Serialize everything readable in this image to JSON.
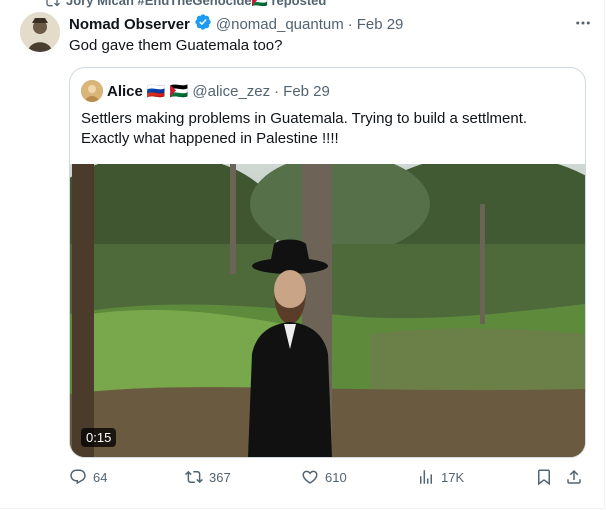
{
  "repost": {
    "label": "Jory Micah #EndTheGenocide🇵🇸 reposted"
  },
  "tweet": {
    "author_name": "Nomad Observer",
    "handle": "@nomad_quantum",
    "separator": "·",
    "date": "Feb 29",
    "text": "God gave them Guatemala too?"
  },
  "quote": {
    "author_name": "Alice",
    "flags": "🇷🇺 🇵🇸",
    "handle": "@alice_zez",
    "separator": "·",
    "date": "Feb 29",
    "text": "Settlers making problems in Guatemala. Trying to build a settlment. Exactly what happened in Palestine !!!!",
    "video_time": "0:15"
  },
  "actions": {
    "replies": "64",
    "reposts": "367",
    "likes": "610",
    "views": "17K"
  },
  "colors": {
    "muted": "#536471",
    "verified": "#1d9bf0",
    "border": "#cfd9de"
  }
}
